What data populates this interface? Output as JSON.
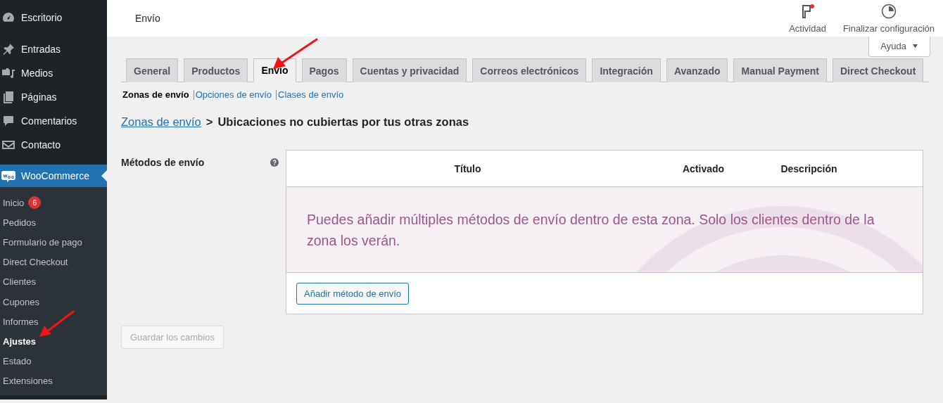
{
  "sidebar": {
    "menu": [
      {
        "label": "Escritorio",
        "selected": false
      },
      {
        "label": "Entradas",
        "selected": false
      },
      {
        "label": "Medios",
        "selected": false
      },
      {
        "label": "Páginas",
        "selected": false
      },
      {
        "label": "Comentarios",
        "selected": false
      },
      {
        "label": "Contacto",
        "selected": false
      },
      {
        "label": "WooCommerce",
        "selected": true
      }
    ],
    "submenu": [
      {
        "label": "Inicio",
        "selected": false,
        "badge": "6"
      },
      {
        "label": "Pedidos",
        "selected": false
      },
      {
        "label": "Formulario de pago",
        "selected": false
      },
      {
        "label": "Direct Checkout",
        "selected": false
      },
      {
        "label": "Clientes",
        "selected": false
      },
      {
        "label": "Cupones",
        "selected": false
      },
      {
        "label": "Informes",
        "selected": false
      },
      {
        "label": "Ajustes",
        "selected": true
      },
      {
        "label": "Estado",
        "selected": false
      },
      {
        "label": "Extensiones",
        "selected": false
      }
    ]
  },
  "header": {
    "title": "Envío",
    "actions": [
      {
        "label": "Actividad",
        "kind": "activity",
        "unread": true
      },
      {
        "label": "Finalizar configuración",
        "kind": "setup"
      }
    ]
  },
  "help_button": {
    "label": "Ayuda"
  },
  "tabs": [
    {
      "label": "General",
      "selected": false
    },
    {
      "label": "Productos",
      "selected": false
    },
    {
      "label": "Envío",
      "selected": true
    },
    {
      "label": "Pagos",
      "selected": false
    },
    {
      "label": "Cuentas y privacidad",
      "selected": false
    },
    {
      "label": "Correos electrónicos",
      "selected": false
    },
    {
      "label": "Integración",
      "selected": false
    },
    {
      "label": "Avanzado",
      "selected": false
    },
    {
      "label": "Manual Payment",
      "selected": false
    },
    {
      "label": "Direct Checkout",
      "selected": false
    }
  ],
  "subnav": [
    {
      "label": "Zonas de envío",
      "selected": true
    },
    {
      "label": "Opciones de envío",
      "selected": false
    },
    {
      "label": "Clases de envío",
      "selected": false
    }
  ],
  "breadcrumb": {
    "link": "Zonas de envío",
    "separator": ">",
    "current": "Ubicaciones no cubiertas por tus otras zonas"
  },
  "form": {
    "label": "Métodos de envío",
    "table": {
      "columns": [
        "Título",
        "Activado",
        "Descripción"
      ],
      "empty_message": "Puedes añadir múltiples métodos de envío dentro de esta zona. Solo los clientes dentro de la zona los verán.",
      "add_button": "Añadir método de envío"
    }
  },
  "save_button": {
    "label": "Guardar los cambios",
    "disabled": true
  }
}
